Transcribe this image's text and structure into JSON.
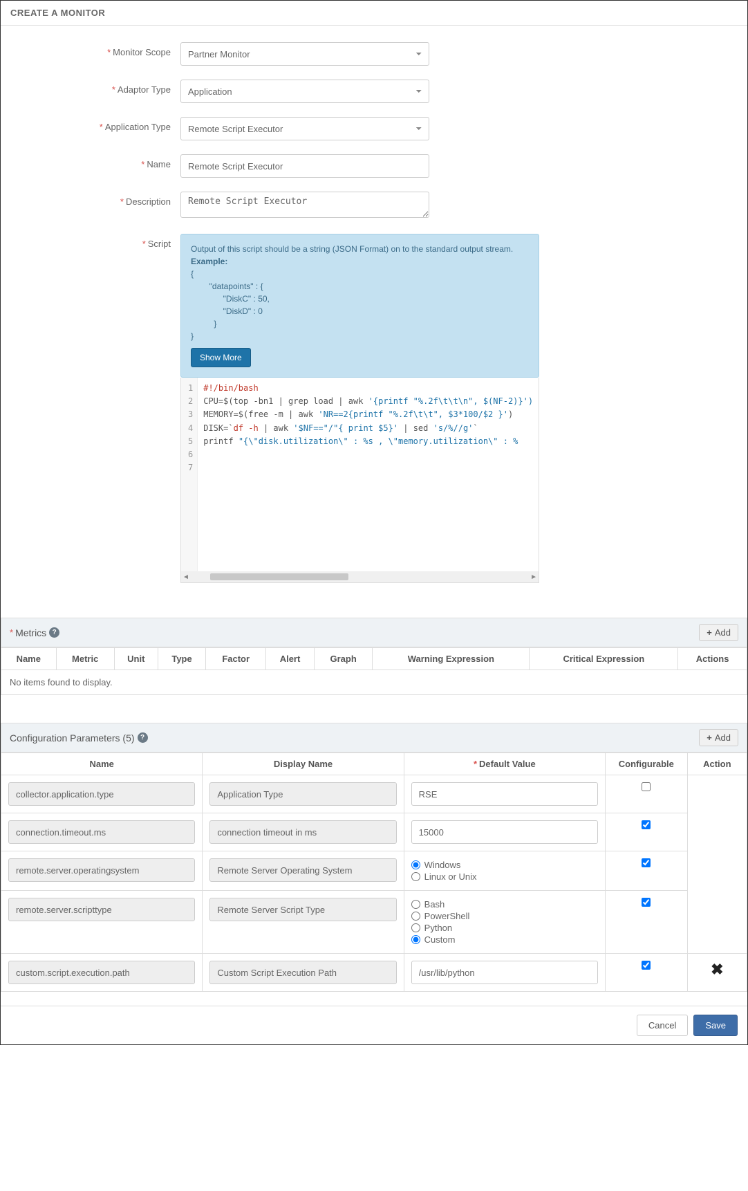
{
  "header": {
    "title": "CREATE A MONITOR"
  },
  "form": {
    "monitor_scope": {
      "label": "Monitor Scope",
      "value": "Partner Monitor"
    },
    "adaptor_type": {
      "label": "Adaptor Type",
      "value": "Application"
    },
    "application_type": {
      "label": "Application Type",
      "value": "Remote Script Executor"
    },
    "name": {
      "label": "Name",
      "value": "Remote Script Executor"
    },
    "description": {
      "label": "Description",
      "value": "Remote Script Executor"
    },
    "script": {
      "label": "Script",
      "info_intro": "Output of this script should be a string (JSON Format) on to the standard output stream.",
      "example_label": "Example:",
      "example_text": "{\n        \"datapoints\" : {\n              \"DiskC\" : 50,\n              \"DiskD\" : 0\n          }\n}",
      "show_more": "Show More",
      "lines": [
        "#!/bin/bash",
        "",
        "CPU=$(top -bn1 | grep load | awk '{printf \"%.2f\\t\\t\\n\", $(NF-2)}')",
        "MEMORY=$(free -m | awk 'NR==2{printf \"%.2f\\t\\t\", $3*100/$2 }')",
        "DISK=`df -h | awk '$NF==\"/\"{ print $5}' | sed 's/%//g'`",
        "",
        "printf \"{\\\"disk.utilization\\\" : %s , \\\"memory.utilization\\\" : %s , \\\"cpu.utilization\\\" : %s}\" $DISK $MEMORY $CPU"
      ]
    }
  },
  "metrics": {
    "title": "Metrics",
    "add_label": "Add",
    "columns": [
      "Name",
      "Metric",
      "Unit",
      "Type",
      "Factor",
      "Alert",
      "Graph",
      "Warning Expression",
      "Critical Expression",
      "Actions"
    ],
    "empty_text": "No items found to display."
  },
  "config": {
    "title": "Configuration Parameters (5)",
    "add_label": "Add",
    "columns": {
      "name": "Name",
      "display_name": "Display Name",
      "default_value": "Default Value",
      "configurable": "Configurable",
      "action": "Action"
    },
    "rows": [
      {
        "name": "collector.application.type",
        "display": "Application Type",
        "value_type": "text",
        "value": "RSE",
        "configurable": false,
        "removable": false
      },
      {
        "name": "connection.timeout.ms",
        "display": "connection timeout in ms",
        "value_type": "text",
        "value": "15000",
        "configurable": true,
        "removable": false
      },
      {
        "name": "remote.server.operatingsystem",
        "display": "Remote Server Operating System",
        "value_type": "radio",
        "options": [
          "Windows",
          "Linux or Unix"
        ],
        "selected": "Windows",
        "configurable": true,
        "removable": false
      },
      {
        "name": "remote.server.scripttype",
        "display": "Remote Server Script Type",
        "value_type": "radio",
        "options": [
          "Bash",
          "PowerShell",
          "Python",
          "Custom"
        ],
        "selected": "Custom",
        "configurable": true,
        "removable": false
      },
      {
        "name": "custom.script.execution.path",
        "display": "Custom Script Execution Path",
        "value_type": "text",
        "value": "/usr/lib/python",
        "configurable": true,
        "removable": true
      }
    ]
  },
  "footer": {
    "cancel": "Cancel",
    "save": "Save"
  }
}
